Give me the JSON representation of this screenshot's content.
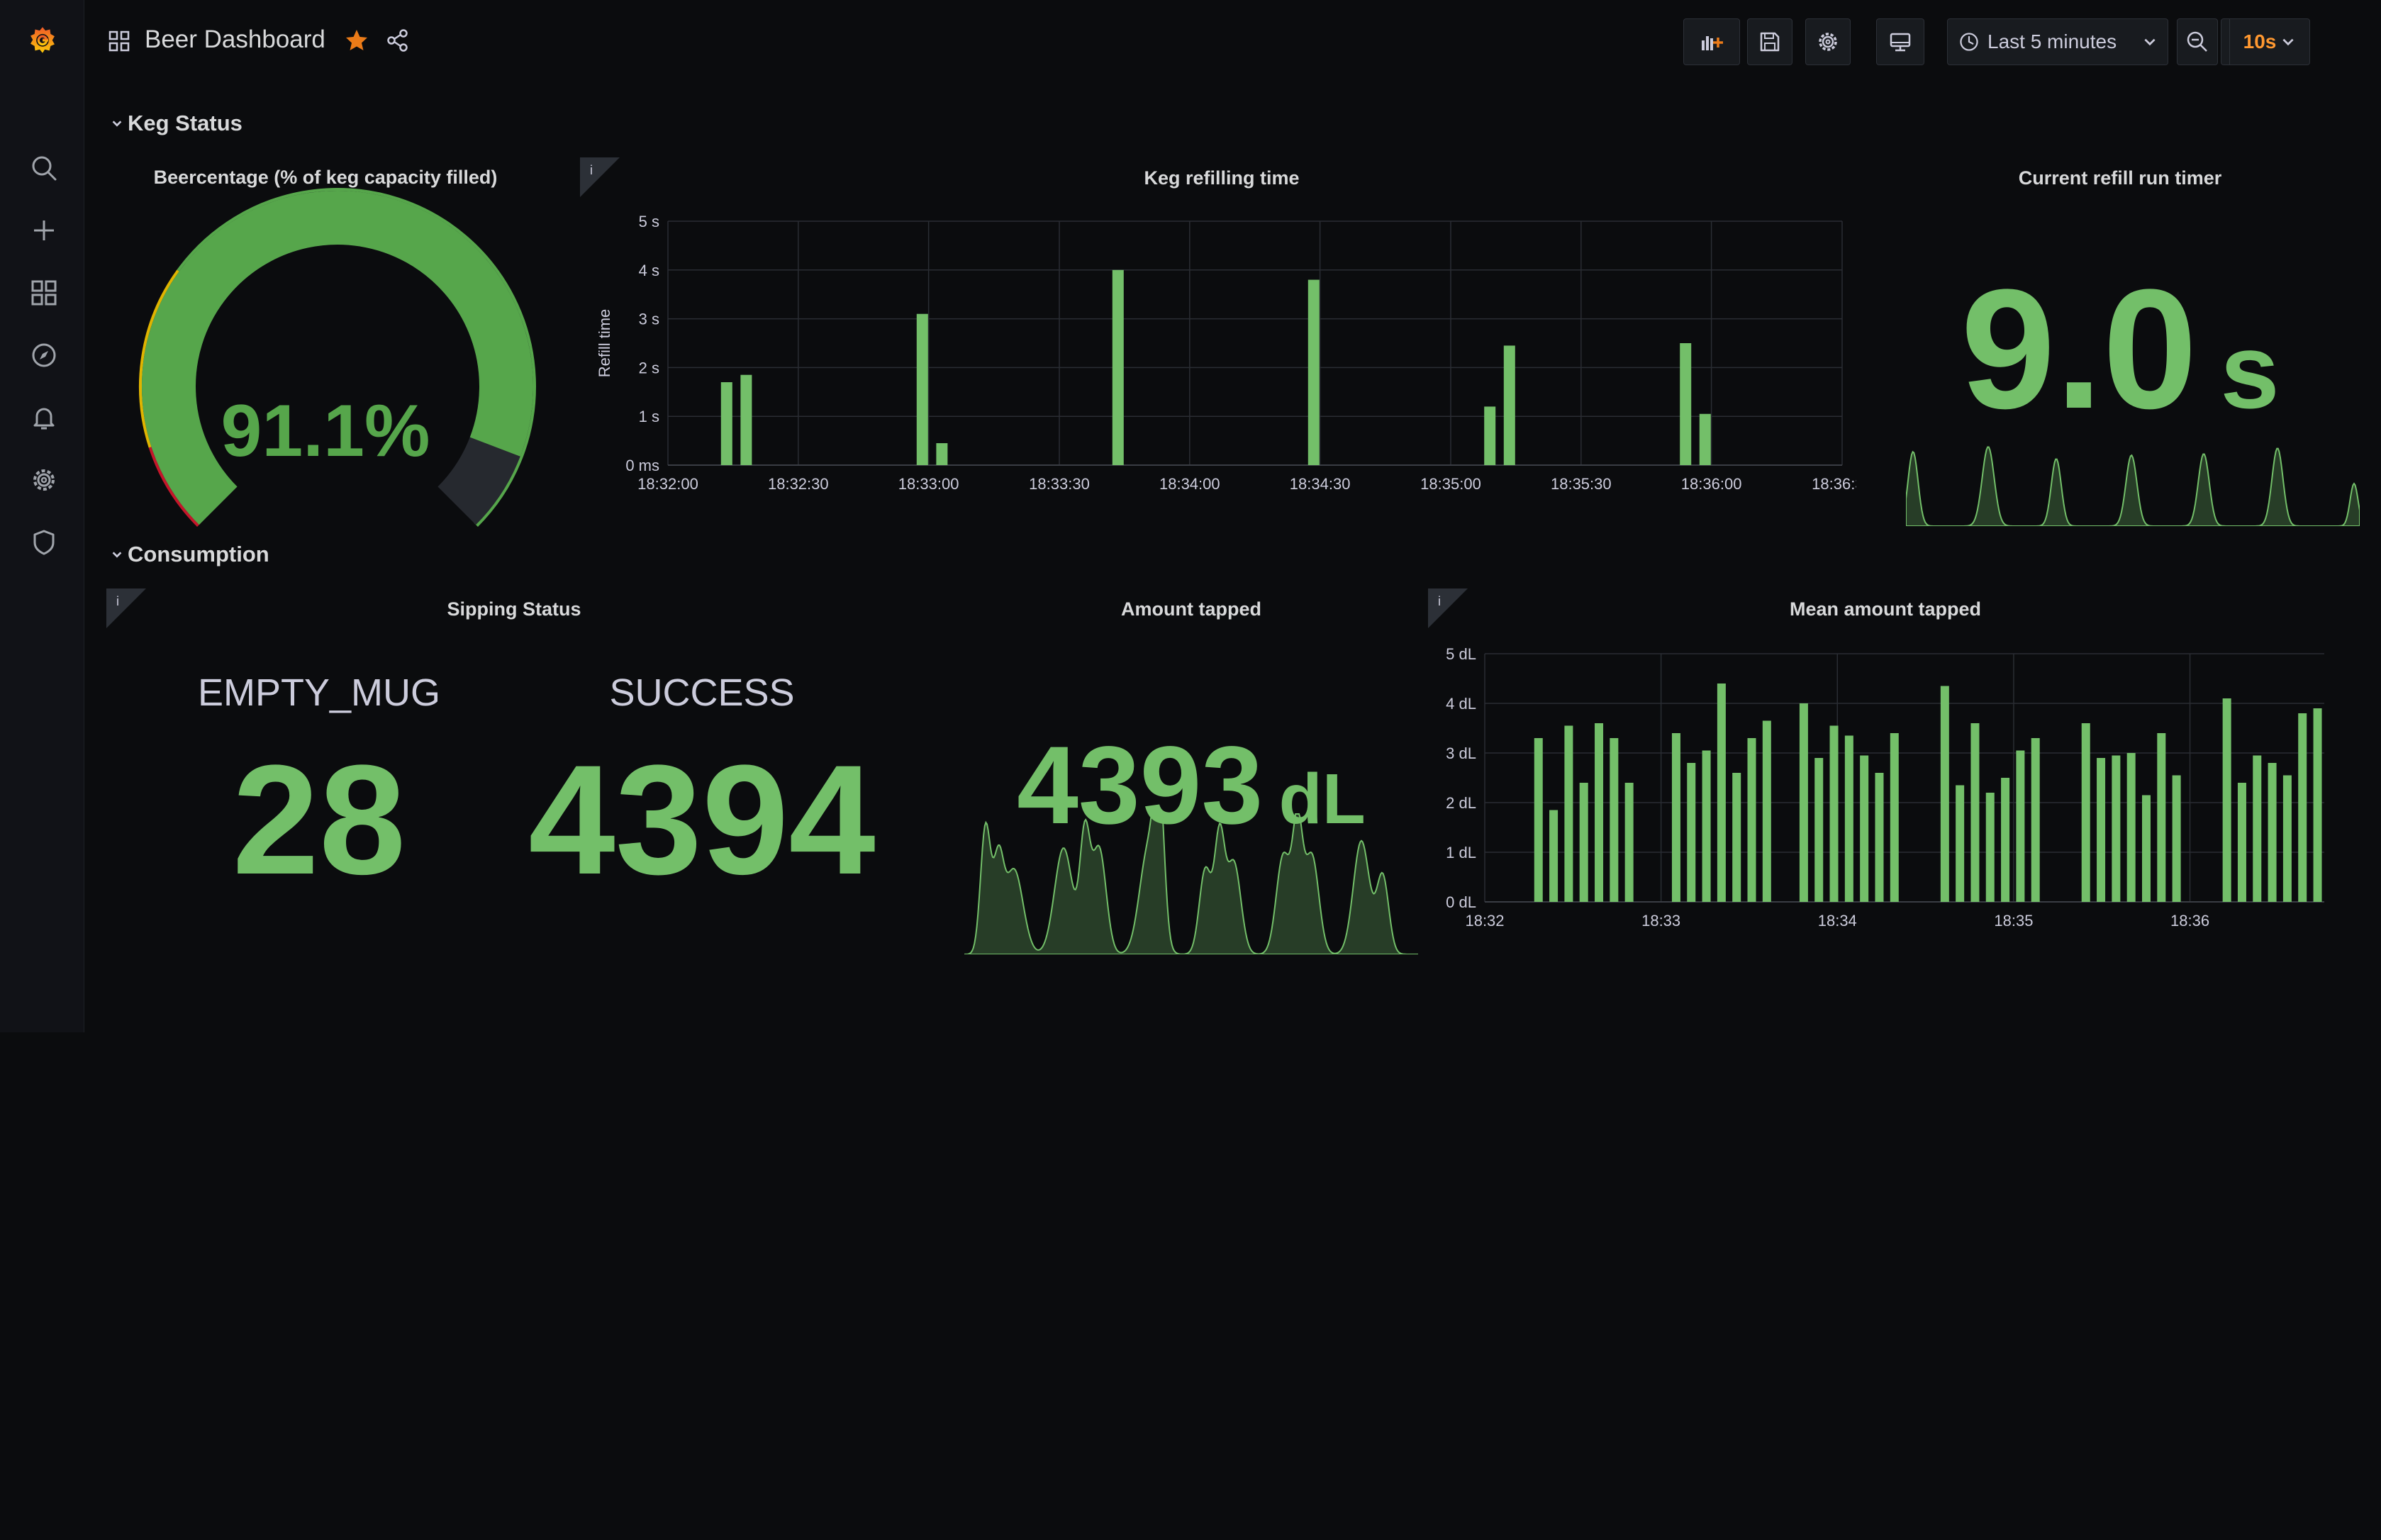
{
  "topnav": {
    "title": "Beer Dashboard",
    "time_range": "Last 5 minutes",
    "refresh_interval": "10s"
  },
  "rows": {
    "keg_status": "Keg Status",
    "consumption": "Consumption"
  },
  "gauge": {
    "title": "Beercentage (% of keg capacity filled)",
    "value": 91.1,
    "display": "91.1%",
    "thresholds": [
      {
        "color": "#c4162a",
        "to": 10
      },
      {
        "color": "#e0b400",
        "to": 30
      },
      {
        "color": "#56a64b",
        "to": 100
      }
    ]
  },
  "refill_chart": {
    "title": "Keg refilling time",
    "info_icon": "i",
    "ylabel": "Refill time",
    "y_ticks": [
      "0 ms",
      "1 s",
      "2 s",
      "3 s",
      "4 s",
      "5 s"
    ],
    "x_ticks": [
      "18:32:00",
      "18:32:30",
      "18:33:00",
      "18:33:30",
      "18:34:00",
      "18:34:30",
      "18:35:00",
      "18:35:30",
      "18:36:00",
      "18:36:30"
    ]
  },
  "refill_timer": {
    "title": "Current refill run timer",
    "value": "9.0",
    "unit": "s"
  },
  "sipping": {
    "title": "Sipping Status",
    "info_icon": "i",
    "items": [
      {
        "label": "EMPTY_MUG",
        "value": "28"
      },
      {
        "label": "SUCCESS",
        "value": "4394"
      }
    ]
  },
  "amount_tapped": {
    "title": "Amount tapped",
    "value": "4393",
    "unit": "dL"
  },
  "mean_chart": {
    "title": "Mean amount tapped",
    "info_icon": "i",
    "y_ticks": [
      "0 dL",
      "1 dL",
      "2 dL",
      "3 dL",
      "4 dL",
      "5 dL"
    ],
    "x_ticks": [
      "18:32",
      "18:33",
      "18:34",
      "18:35",
      "18:36"
    ]
  },
  "chart_data": [
    {
      "type": "bar",
      "title": "Keg refilling time",
      "ylabel": "Refill time",
      "unit": "s",
      "ylim": [
        0,
        5
      ],
      "x_range_seconds_from_18:32:00": [
        0,
        300
      ],
      "points": [
        {
          "t": 15,
          "v": 1.7
        },
        {
          "t": 20,
          "v": 1.85
        },
        {
          "t": 65,
          "v": 3.1
        },
        {
          "t": 70,
          "v": 0.45
        },
        {
          "t": 115,
          "v": 4.0
        },
        {
          "t": 165,
          "v": 3.8
        },
        {
          "t": 210,
          "v": 1.2
        },
        {
          "t": 215,
          "v": 2.45
        },
        {
          "t": 260,
          "v": 2.5
        },
        {
          "t": 265,
          "v": 1.05
        }
      ],
      "color": "#73bf69"
    },
    {
      "type": "bar",
      "title": "Mean amount tapped",
      "unit": "dL",
      "ylim": [
        0,
        5
      ],
      "x_range_minutes_from_18:32": [
        0,
        5
      ],
      "points": [
        {
          "t": 0.32,
          "v": 3.3
        },
        {
          "t": 0.41,
          "v": 1.85
        },
        {
          "t": 0.5,
          "v": 3.55
        },
        {
          "t": 0.59,
          "v": 2.4
        },
        {
          "t": 0.68,
          "v": 3.6
        },
        {
          "t": 0.77,
          "v": 3.3
        },
        {
          "t": 0.86,
          "v": 2.4
        },
        {
          "t": 1.14,
          "v": 3.4
        },
        {
          "t": 1.23,
          "v": 2.8
        },
        {
          "t": 1.32,
          "v": 3.05
        },
        {
          "t": 1.41,
          "v": 4.4
        },
        {
          "t": 1.5,
          "v": 2.6
        },
        {
          "t": 1.59,
          "v": 3.3
        },
        {
          "t": 1.68,
          "v": 3.65
        },
        {
          "t": 1.9,
          "v": 4.0
        },
        {
          "t": 1.99,
          "v": 2.9
        },
        {
          "t": 2.08,
          "v": 3.55
        },
        {
          "t": 2.17,
          "v": 3.35
        },
        {
          "t": 2.26,
          "v": 2.95
        },
        {
          "t": 2.35,
          "v": 2.6
        },
        {
          "t": 2.44,
          "v": 3.4
        },
        {
          "t": 2.74,
          "v": 4.35
        },
        {
          "t": 2.83,
          "v": 2.35
        },
        {
          "t": 2.92,
          "v": 3.6
        },
        {
          "t": 3.01,
          "v": 2.2
        },
        {
          "t": 3.1,
          "v": 2.5
        },
        {
          "t": 3.19,
          "v": 3.05
        },
        {
          "t": 3.28,
          "v": 3.3
        },
        {
          "t": 3.58,
          "v": 3.6
        },
        {
          "t": 3.67,
          "v": 2.9
        },
        {
          "t": 3.76,
          "v": 2.95
        },
        {
          "t": 3.85,
          "v": 3.0
        },
        {
          "t": 3.94,
          "v": 2.15
        },
        {
          "t": 4.03,
          "v": 3.4
        },
        {
          "t": 4.12,
          "v": 2.55
        },
        {
          "t": 4.42,
          "v": 4.1
        },
        {
          "t": 4.51,
          "v": 2.4
        },
        {
          "t": 4.6,
          "v": 2.95
        },
        {
          "t": 4.69,
          "v": 2.8
        },
        {
          "t": 4.78,
          "v": 2.55
        },
        {
          "t": 4.87,
          "v": 3.8
        },
        {
          "t": 4.96,
          "v": 3.9
        }
      ],
      "color": "#73bf69"
    }
  ],
  "colors": {
    "accent_green": "#73bf69",
    "gauge_green": "#56a64b",
    "star": "#eb7b18",
    "refresh": "#ff9830"
  }
}
